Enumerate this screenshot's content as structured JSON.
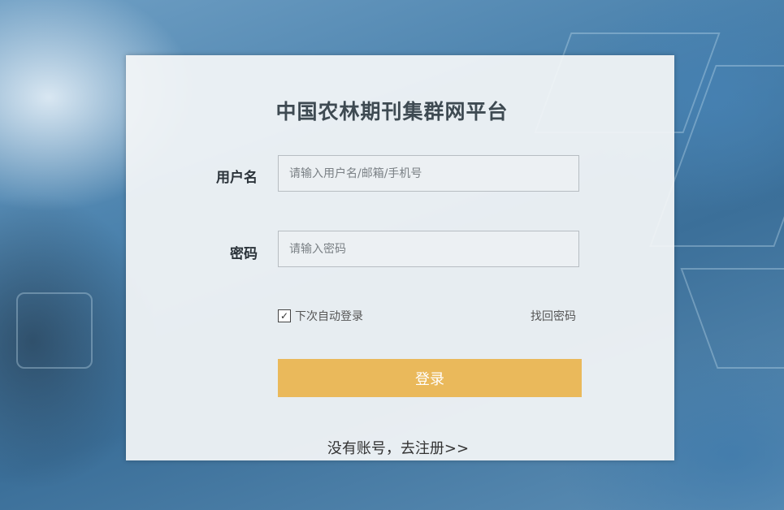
{
  "page": {
    "title": "中国农林期刊集群网平台"
  },
  "form": {
    "username_label": "用户名",
    "username_placeholder": "请输入用户名/邮箱/手机号",
    "username_value": "",
    "password_label": "密码",
    "password_placeholder": "请输入密码",
    "password_value": "",
    "remember_label": "下次自动登录",
    "remember_checked": true,
    "forgot_label": "找回密码",
    "login_label": "登录",
    "register_link": "没有账号，去注册>>"
  },
  "colors": {
    "login_button": "#eab95b",
    "title_text": "#3e4a52"
  }
}
